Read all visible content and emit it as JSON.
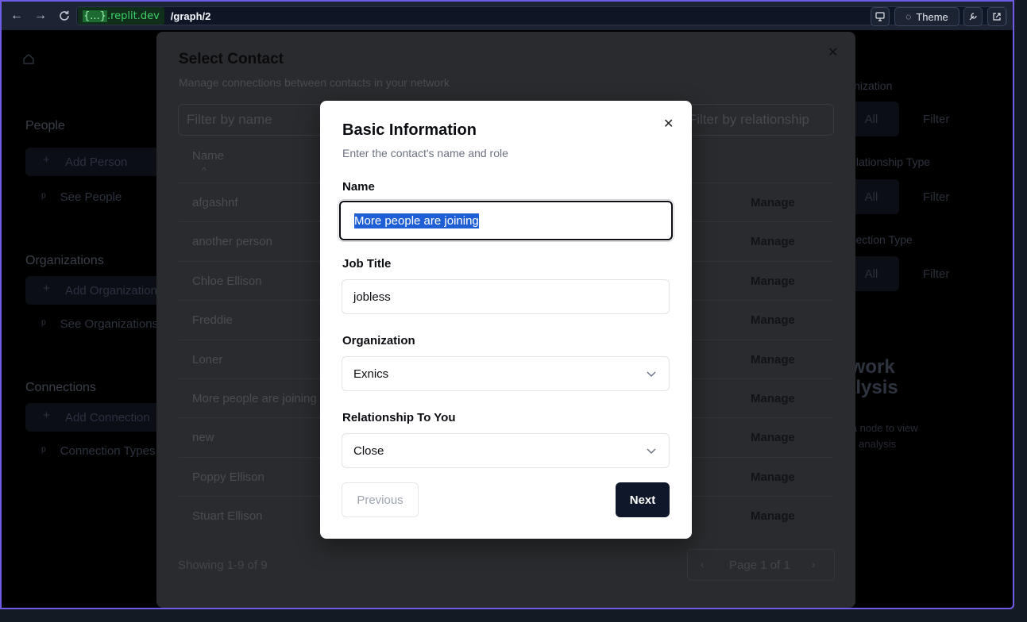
{
  "browser": {
    "domain_highlight": "{...}",
    "domain_rest": ".replit.dev",
    "path": "/graph/2",
    "theme_label": "Theme",
    "nav_icons": [
      "back-icon",
      "forward-icon",
      "reload-icon"
    ]
  },
  "colors": {
    "accent_border": "#6e5ce6",
    "domain_green": "#3fd26a",
    "primary_button": "#0f172a"
  },
  "sidebar": {
    "sections": [
      {
        "label": "People",
        "button": "Add Person",
        "link": "See People"
      },
      {
        "label": "Organizations",
        "button": "Add Organization",
        "link": "See Organizations"
      },
      {
        "label": "Connections",
        "button": "Add Connection",
        "link": "Connection Types"
      }
    ]
  },
  "right_panel": {
    "filters": [
      {
        "label": "Organization",
        "all": "All",
        "filter": "Filter"
      },
      {
        "label": "Relationship Type",
        "all": "All",
        "filter": "Filter"
      },
      {
        "label": "Connection Type",
        "all": "All",
        "filter": "Filter"
      }
    ],
    "heading_line1": "Network",
    "heading_line2": "Analysis",
    "hint_line1": "Select a node to view",
    "hint_line2": "detailed analysis"
  },
  "contact_panel": {
    "title": "Select Contact",
    "subtitle": "Manage connections between contacts in your network",
    "filter_name_placeholder": "Filter by name",
    "filter_relationship_placeholder": "Filter by relationship",
    "column_name": "Name",
    "rows": [
      {
        "name": "afgashnf",
        "action": "Manage"
      },
      {
        "name": "another person",
        "action": "Manage"
      },
      {
        "name": "Chloe Ellison",
        "action": "Manage"
      },
      {
        "name": "Freddie",
        "action": "Manage"
      },
      {
        "name": "Loner",
        "action": "Manage"
      },
      {
        "name": "More people are joining",
        "action": "Manage"
      },
      {
        "name": "new",
        "action": "Manage"
      },
      {
        "name": "Poppy Ellison",
        "action": "Manage"
      },
      {
        "name": "Stuart Ellison",
        "action": "Manage"
      }
    ],
    "showing": "Showing 1-9 of 9",
    "page": "Page 1 of 1"
  },
  "modal": {
    "title": "Basic Information",
    "subtitle": "Enter the contact's name and role",
    "name_label": "Name",
    "name_value": "More people are joining",
    "job_label": "Job Title",
    "job_value": "jobless",
    "org_label": "Organization",
    "org_value": "Exnics",
    "rel_label": "Relationship To You",
    "rel_value": "Close",
    "prev_label": "Previous",
    "next_label": "Next"
  }
}
